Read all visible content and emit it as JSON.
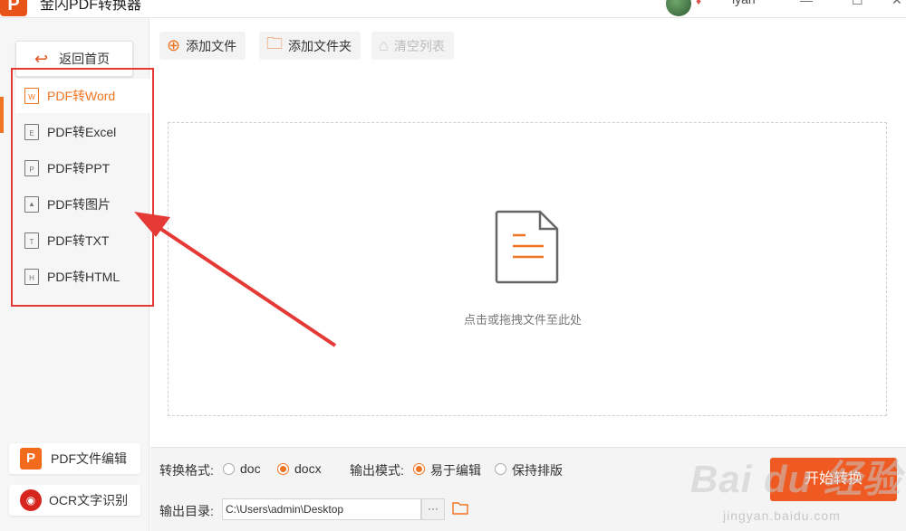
{
  "app": {
    "title": "金闪PDF转换器",
    "username": "lyan",
    "logo_letter": "P"
  },
  "sidebar": {
    "home_label": "返回首页",
    "items": [
      {
        "label": "PDF转Word",
        "icon_letter": "W",
        "active": true
      },
      {
        "label": "PDF转Excel",
        "icon_letter": "E",
        "active": false
      },
      {
        "label": "PDF转PPT",
        "icon_letter": "P",
        "active": false
      },
      {
        "label": "PDF转图片",
        "icon_letter": "",
        "active": false
      },
      {
        "label": "PDF转TXT",
        "icon_letter": "T",
        "active": false
      },
      {
        "label": "PDF转HTML",
        "icon_letter": "H",
        "active": false
      }
    ],
    "pdf_editor_label": "PDF文件编辑",
    "ocr_label": "OCR文字识别"
  },
  "toolbar": {
    "add_file": "添加文件",
    "add_folder": "添加文件夹",
    "clear_list": "清空列表"
  },
  "dropzone": {
    "hint": "点击或拖拽文件至此处"
  },
  "settings": {
    "format_label": "转换格式:",
    "format_options": [
      "doc",
      "docx"
    ],
    "format_selected": "docx",
    "mode_label": "输出模式:",
    "mode_options": [
      "易于编辑",
      "保持排版"
    ],
    "mode_selected": "易于编辑",
    "output_dir_label": "输出目录:",
    "output_dir": "C:\\Users\\admin\\Desktop",
    "browse": "···",
    "start_label": "开始转换"
  },
  "watermark": {
    "main": "Bai du 经验",
    "url": "jingyan.baidu.com"
  },
  "colors": {
    "accent": "#f07422",
    "annotation": "#e53935",
    "start_button": "#ef5a22"
  }
}
